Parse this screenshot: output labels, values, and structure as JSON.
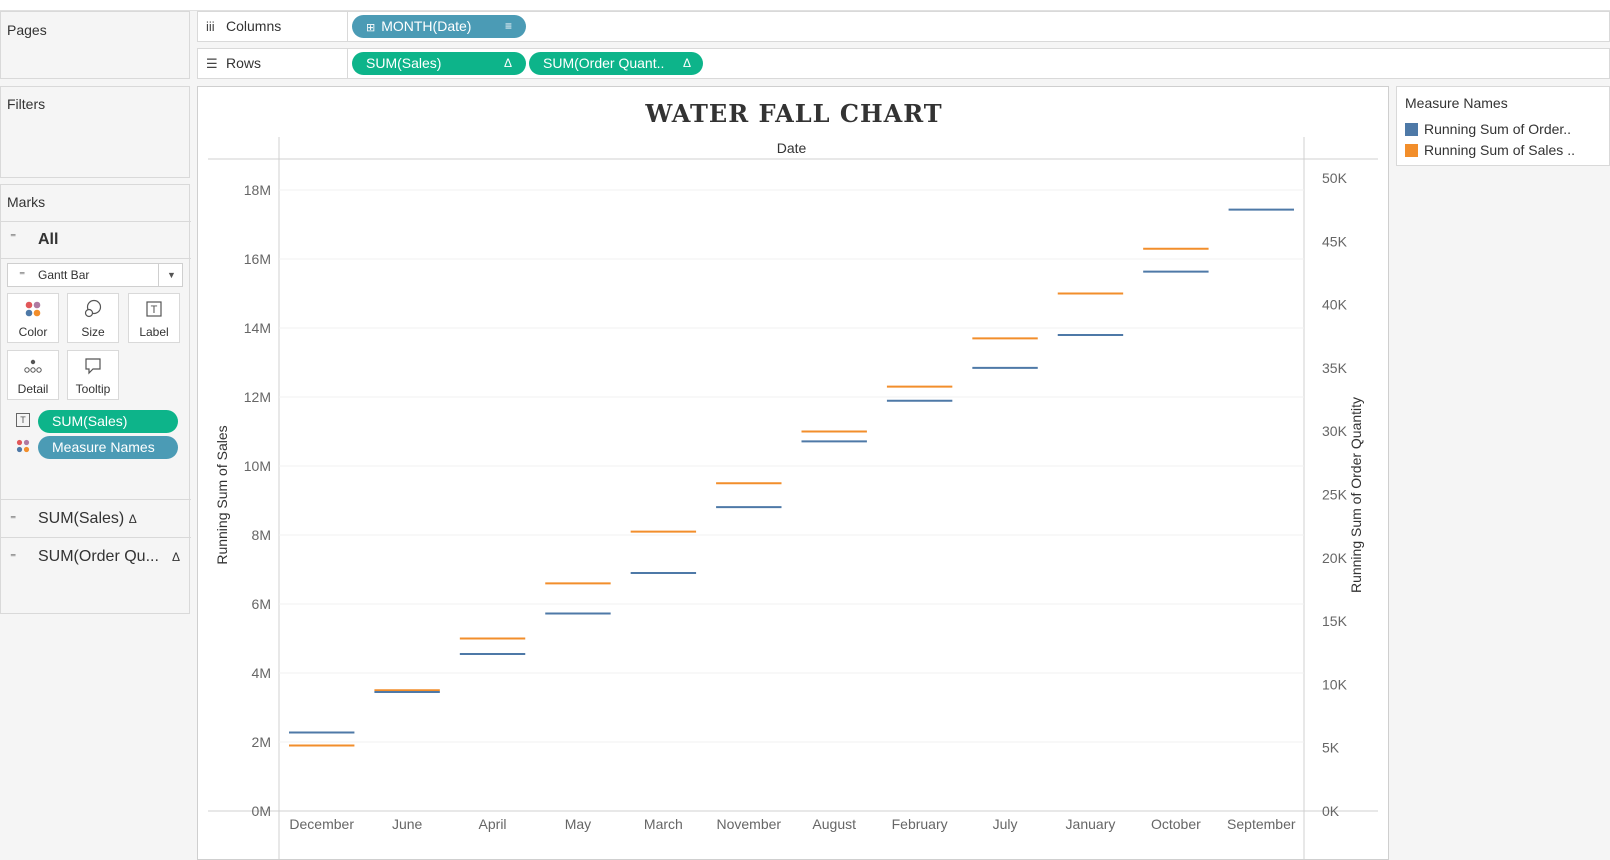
{
  "panels": {
    "pages": "Pages",
    "filters": "Filters",
    "marks": "Marks"
  },
  "shelves": {
    "columns_label": "Columns",
    "rows_label": "Rows",
    "columns_pill": "MONTH(Date)",
    "rows_pill_1": "SUM(Sales)",
    "rows_pill_2": "SUM(Order Quant..",
    "delta": "Δ"
  },
  "marks": {
    "all_label": "All",
    "mark_type": "Gantt Bar",
    "buttons": [
      "Color",
      "Size",
      "Label",
      "Detail",
      "Tooltip"
    ],
    "pills": [
      "SUM(Sales)",
      "Measure Names"
    ],
    "rows": [
      "SUM(Sales)",
      "SUM(Order Qu..."
    ],
    "delta": "Δ"
  },
  "legend": {
    "title": "Measure Names",
    "items": [
      {
        "label": "Running Sum of Order..",
        "color": "#4e79a7"
      },
      {
        "label": "Running Sum of Sales ..",
        "color": "#f28e2b"
      }
    ]
  },
  "chart_data": {
    "type": "gantt",
    "title": "WATER FALL CHART",
    "header": "Date",
    "categories": [
      "December",
      "June",
      "April",
      "May",
      "March",
      "November",
      "August",
      "February",
      "July",
      "January",
      "October",
      "September"
    ],
    "ylabel_left": "Running Sum of Sales",
    "ylabel_right": "Running Sum of Order Quantity",
    "left_ticks": [
      "0M",
      "2M",
      "4M",
      "6M",
      "8M",
      "10M",
      "12M",
      "14M",
      "16M",
      "18M"
    ],
    "right_ticks": [
      "0K",
      "5K",
      "10K",
      "15K",
      "20K",
      "25K",
      "30K",
      "35K",
      "40K",
      "45K",
      "50K"
    ],
    "left_ylim": [
      0,
      18900000
    ],
    "right_ylim": [
      0,
      51500
    ],
    "series": [
      {
        "name": "Running Sum of Sales",
        "axis": "left",
        "color": "#f28e2b",
        "values": [
          1900000,
          3500000,
          5000000,
          6600000,
          8100000,
          9500000,
          11000000,
          12300000,
          13700000,
          15000000,
          16300000,
          null
        ]
      },
      {
        "name": "Running Sum of Order Quantity",
        "axis": "right",
        "color": "#4e79a7",
        "values": [
          6200,
          9400,
          12400,
          15600,
          18800,
          24000,
          29200,
          32400,
          35000,
          37600,
          42600,
          47500
        ]
      }
    ]
  }
}
